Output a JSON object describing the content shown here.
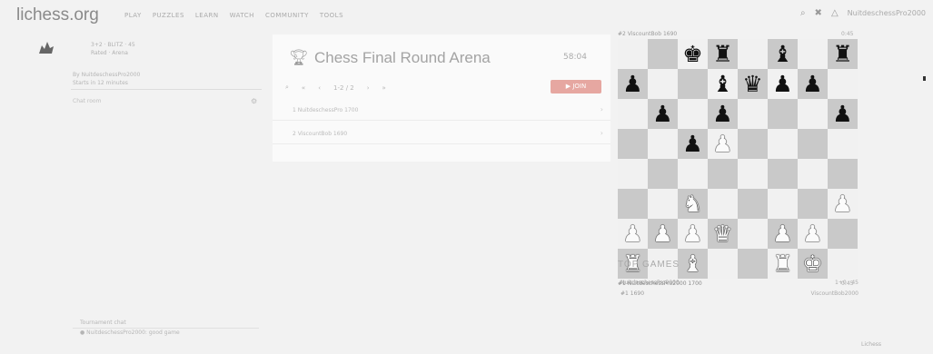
{
  "header": {
    "logo": "lichess.org",
    "nav": [
      "PLAY",
      "PUZZLES",
      "LEARN",
      "WATCH",
      "COMMUNITY",
      "TOOLS"
    ],
    "icons": [
      "search-icon",
      "cross-icon",
      "bell-icon"
    ],
    "username": "NuitdeschessPro2000"
  },
  "sidebar": {
    "heading_lines": [
      "3+2 · BLITZ · 45",
      "Rated · Arena"
    ],
    "meta_lines": [
      "By NuitdeschessPro2000",
      "Starts in 12 minutes"
    ],
    "chat_label": "Chat room",
    "footer_lines": [
      "Tournament chat",
      "● NuitdeschessPro2000: good game"
    ]
  },
  "tournament": {
    "title": "Chess Final Round Arena",
    "timer": "58:04",
    "pager": [
      "«",
      "‹",
      "1-2 / 2",
      "›",
      "»"
    ],
    "join_label": "▶ JOIN",
    "players": [
      {
        "name": "1  NuitdeschessPro  1700",
        "arrow": "›"
      },
      {
        "name": "2  ViscountBob  1690",
        "arrow": "›"
      }
    ]
  },
  "board": {
    "top_player": "#2  ViscountBob  1690",
    "top_right": "0:45",
    "bottom_player": "#1  NuitdeschessPro2000  1700",
    "bottom_right": "0:45",
    "position": [
      [
        "",
        "",
        "bk",
        "br",
        "",
        "bb",
        "",
        "br"
      ],
      [
        "bp",
        "",
        "",
        "bb",
        "bq",
        "bp",
        "bp",
        ""
      ],
      [
        "",
        "bp",
        "",
        "bp",
        "",
        "",
        "",
        "bp"
      ],
      [
        "",
        "",
        "bp",
        "wp",
        "",
        "",
        "",
        ""
      ],
      [
        "",
        "",
        "",
        "",
        "",
        "",
        "",
        ""
      ],
      [
        "",
        "",
        "wn",
        "",
        "",
        "",
        "",
        "wp"
      ],
      [
        "wp",
        "wp",
        "wp",
        "wq",
        "",
        "wp",
        "wp",
        ""
      ],
      [
        "wr",
        "",
        "wb",
        "",
        "",
        "wr",
        "wk",
        ""
      ]
    ]
  },
  "top_games": {
    "title": "TOP GAMES",
    "games": [
      {
        "left": "NuitdeschessPro2000",
        "right": "1+0 · 45"
      },
      {
        "left": "#1  1690",
        "right": "ViscountBob2000"
      }
    ]
  },
  "footer": {
    "corner": "Lichess"
  }
}
